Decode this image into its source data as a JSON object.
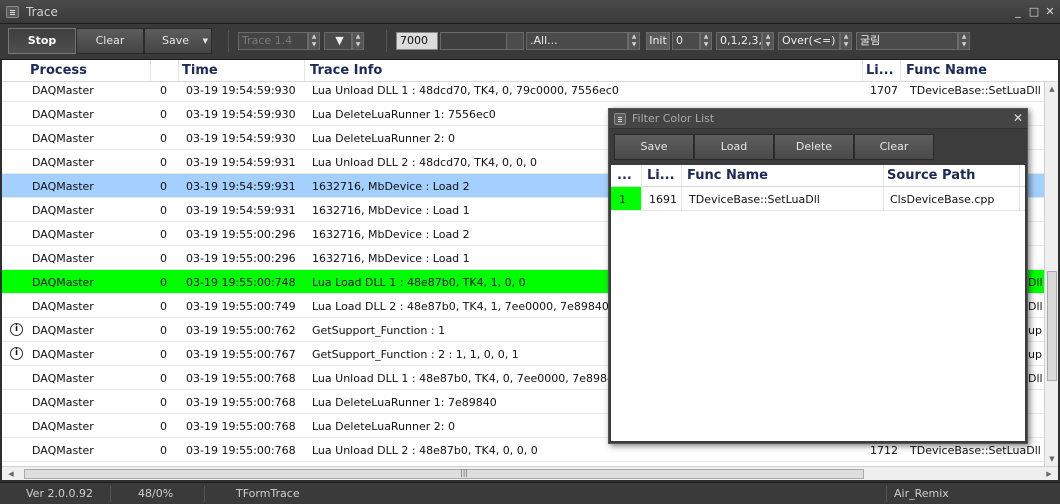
{
  "window": {
    "title": "Trace"
  },
  "toolbar": {
    "stop_label": "Stop",
    "clear_label": "Clear",
    "save_label": "Save",
    "trace_select": "Trace 1.4",
    "buffer_value": "7000",
    "process_filter": ".All...",
    "init_label": "Init",
    "init_value": "0",
    "levels_value": "0,1,2,3,",
    "level_mode": "Over(<=)",
    "font_value": "굴림"
  },
  "grid": {
    "columns": {
      "process": "Process",
      "time": "Time",
      "trace_info": "Trace Info",
      "line": "Li...",
      "func_name": "Func Name"
    },
    "rows": [
      {
        "process": "DAQMaster",
        "num": "0",
        "time": "03-19 19:54:59:930",
        "info": "Lua Unload DLL 1 : 48dcd70, TK4, 0, 79c0000, 7556ec0",
        "line": "1707",
        "func": "TDeviceBase::SetLuaDll",
        "state": "normal",
        "icon": false
      },
      {
        "process": "DAQMaster",
        "num": "0",
        "time": "03-19 19:54:59:930",
        "info": "Lua DeleteLuaRunner 1: 7556ec0",
        "line": "",
        "func": "",
        "state": "normal",
        "icon": false
      },
      {
        "process": "DAQMaster",
        "num": "0",
        "time": "03-19 19:54:59:930",
        "info": "Lua DeleteLuaRunner 2: 0",
        "line": "",
        "func": "",
        "state": "normal",
        "icon": false
      },
      {
        "process": "DAQMaster",
        "num": "0",
        "time": "03-19 19:54:59:931",
        "info": "Lua Unload DLL 2 : 48dcd70, TK4, 0, 0, 0",
        "line": "",
        "func": "",
        "state": "normal",
        "icon": false
      },
      {
        "process": "DAQMaster",
        "num": "0",
        "time": "03-19 19:54:59:931",
        "info": "1632716, MbDevice : Load 2",
        "line": "",
        "func": "",
        "state": "selected",
        "icon": false
      },
      {
        "process": "DAQMaster",
        "num": "0",
        "time": "03-19 19:54:59:931",
        "info": "1632716, MbDevice : Load 1",
        "line": "",
        "func": "",
        "state": "normal",
        "icon": false
      },
      {
        "process": "DAQMaster",
        "num": "0",
        "time": "03-19 19:55:00:296",
        "info": "1632716, MbDevice : Load 2",
        "line": "",
        "func": "",
        "state": "normal",
        "icon": false
      },
      {
        "process": "DAQMaster",
        "num": "0",
        "time": "03-19 19:55:00:296",
        "info": "1632716, MbDevice : Load 1",
        "line": "",
        "func": "",
        "state": "normal",
        "icon": false
      },
      {
        "process": "DAQMaster",
        "num": "0",
        "time": "03-19 19:55:00:748",
        "info": "Lua Load DLL 1 : 48e87b0, TK4, 1, 0, 0",
        "line": "",
        "func": "Dll",
        "state": "highlight",
        "icon": false
      },
      {
        "process": "DAQMaster",
        "num": "0",
        "time": "03-19 19:55:00:749",
        "info": "Lua Load DLL 2 : 48e87b0, TK4, 1, 7ee0000, 7e89840",
        "line": "",
        "func": "Dll",
        "state": "normal",
        "icon": false
      },
      {
        "process": "DAQMaster",
        "num": "0",
        "time": "03-19 19:55:00:762",
        "info": "GetSupport_Function : 1",
        "line": "",
        "func": "up",
        "state": "normal",
        "icon": true
      },
      {
        "process": "DAQMaster",
        "num": "0",
        "time": "03-19 19:55:00:767",
        "info": "GetSupport_Function : 2 : 1, 1, 0, 0, 1",
        "line": "",
        "func": "up",
        "state": "normal",
        "icon": true
      },
      {
        "process": "DAQMaster",
        "num": "0",
        "time": "03-19 19:55:00:768",
        "info": "Lua Unload DLL 1 : 48e87b0, TK4, 0, 7ee0000, 7e89840",
        "line": "",
        "func": "Dll",
        "state": "normal",
        "icon": false
      },
      {
        "process": "DAQMaster",
        "num": "0",
        "time": "03-19 19:55:00:768",
        "info": "Lua DeleteLuaRunner 1: 7e89840",
        "line": "",
        "func": "",
        "state": "normal",
        "icon": false
      },
      {
        "process": "DAQMaster",
        "num": "0",
        "time": "03-19 19:55:00:768",
        "info": "Lua DeleteLuaRunner 2: 0",
        "line": "",
        "func": "",
        "state": "normal",
        "icon": false
      },
      {
        "process": "DAQMaster",
        "num": "0",
        "time": "03-19 19:55:00:768",
        "info": "Lua Unload DLL 2 : 48e87b0, TK4, 0, 0, 0",
        "line": "1712",
        "func": "TDeviceBase::SetLuaDll",
        "state": "normal",
        "icon": false
      }
    ]
  },
  "statusbar": {
    "version": "Ver 2.0.0.92",
    "ratio": "48/0%",
    "form": "TFormTrace",
    "skin": "Air_Remix"
  },
  "dialog": {
    "title": "Filter Color List",
    "save_label": "Save",
    "load_label": "Load",
    "delete_label": "Delete",
    "clear_label": "Clear",
    "columns": {
      "color": "...",
      "line": "Li...",
      "func_name": "Func Name",
      "source_path": "Source Path"
    },
    "rows": [
      {
        "color_index": "1",
        "line": "1691",
        "func": "TDeviceBase::SetLuaDll",
        "source": "ClsDeviceBase.cpp"
      }
    ]
  },
  "colors": {
    "highlight": "#00ff00",
    "selected": "#a3d0ff",
    "header_text": "#1c2a5a"
  }
}
